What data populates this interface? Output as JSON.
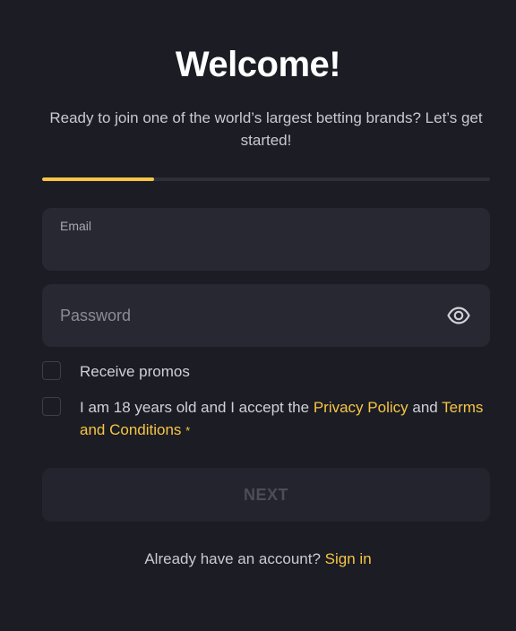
{
  "header": {
    "title": "Welcome!",
    "subtitle": "Ready to join one of the world’s largest betting brands? Let’s get started!"
  },
  "progress": {
    "fraction": 0.25,
    "color": "#f6c544"
  },
  "email": {
    "label": "Email",
    "value": ""
  },
  "password": {
    "placeholder": "Password",
    "value": "",
    "toggle_icon": "eye-icon"
  },
  "promos": {
    "label": "Receive promos",
    "checked": false
  },
  "terms": {
    "prefix": "I am 18 years old and I accept the ",
    "privacy_link": "Privacy Policy",
    "and": " and ",
    "terms_link": "Terms and Conditions",
    "required_mark": "*",
    "checked": false
  },
  "actions": {
    "next_label": "NEXT"
  },
  "footer": {
    "prompt": "Already have an account?",
    "signin_link": "Sign in"
  },
  "colors": {
    "background": "#1b1c24",
    "accent": "#f6c544",
    "field": "#272832"
  }
}
